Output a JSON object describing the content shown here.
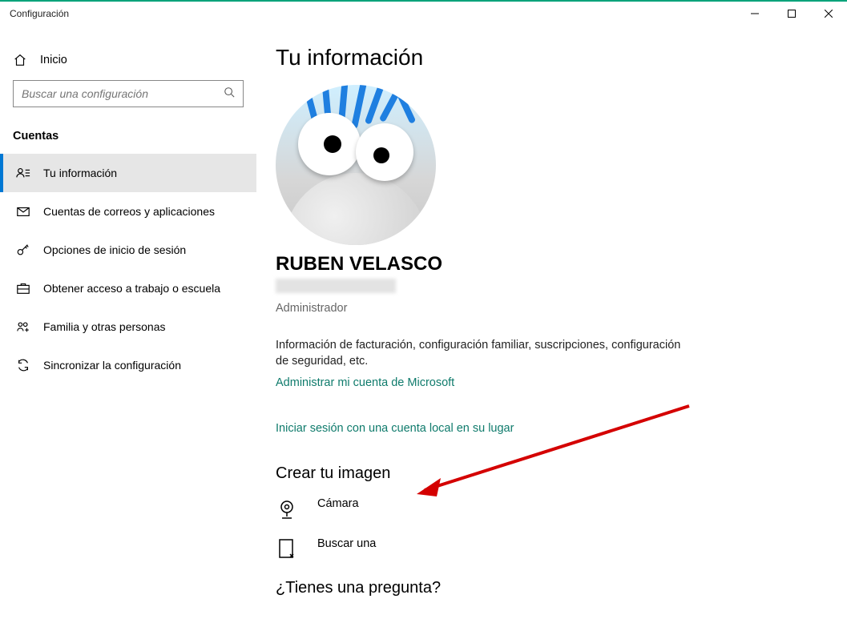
{
  "window": {
    "title": "Configuración"
  },
  "sidebar": {
    "home_label": "Inicio",
    "search_placeholder": "Buscar una configuración",
    "section_header": "Cuentas",
    "items": [
      {
        "label": "Tu información"
      },
      {
        "label": "Cuentas de correos y aplicaciones"
      },
      {
        "label": "Opciones de inicio de sesión"
      },
      {
        "label": "Obtener acceso a trabajo o escuela"
      },
      {
        "label": "Familia y otras personas"
      },
      {
        "label": "Sincronizar la configuración"
      }
    ]
  },
  "main": {
    "title": "Tu información",
    "user_name": "RUBEN VELASCO",
    "role": "Administrador",
    "description": "Información de facturación, configuración familiar, suscripciones, configuración de seguridad, etc.",
    "manage_link": "Administrar mi cuenta de Microsoft",
    "local_link": "Iniciar sesión con una cuenta local en su lugar",
    "create_image_header": "Crear tu imagen",
    "options": {
      "camera": "Cámara",
      "browse": "Buscar una"
    },
    "question_header": "¿Tienes una pregunta?"
  }
}
